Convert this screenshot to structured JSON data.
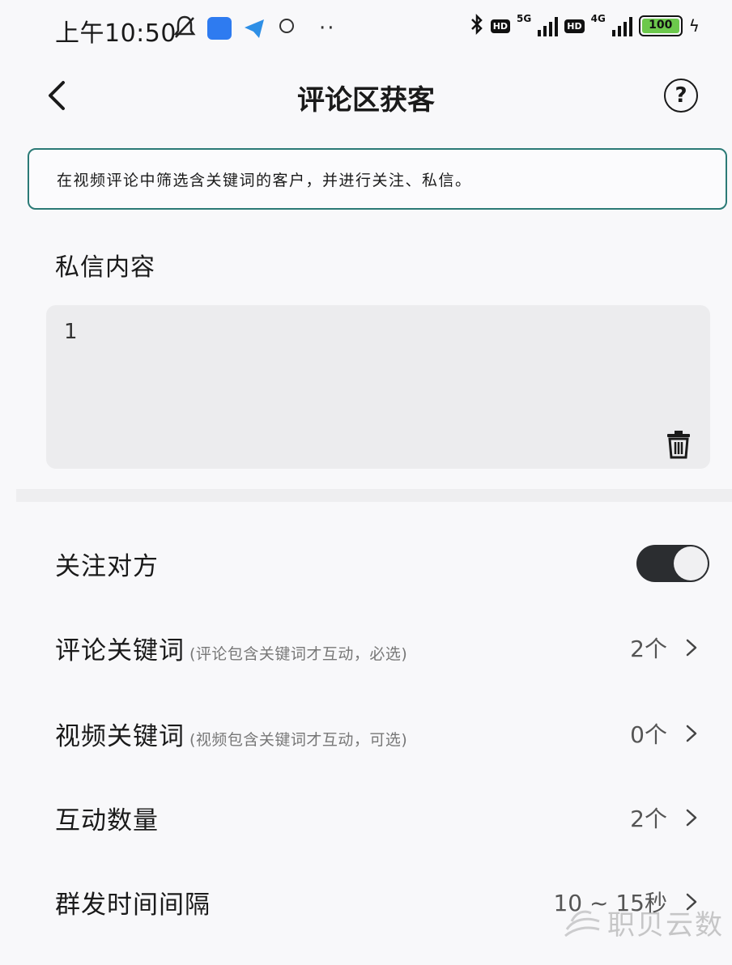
{
  "status_bar": {
    "time": "上午10:50",
    "dots": "··",
    "net1": "5G",
    "net2": "4G",
    "hd": "HD",
    "battery": "100"
  },
  "header": {
    "title": "评论区获客",
    "help_symbol": "?"
  },
  "banner": {
    "text": "在视频评论中筛选含关键词的客户，并进行关注、私信。"
  },
  "message": {
    "label": "私信内容",
    "value": "1"
  },
  "settings": {
    "follow": {
      "label": "关注对方",
      "enabled": true
    },
    "rows": [
      {
        "label": "评论关键词",
        "hint": "(评论包含关键词才互动，必选)",
        "value": "2个"
      },
      {
        "label": "视频关键词",
        "hint": "(视频包含关键词才互动，可选)",
        "value": "0个"
      },
      {
        "label": "互动数量",
        "hint": "",
        "value": "2个"
      },
      {
        "label": "群发时间间隔",
        "hint": "",
        "value": "10 ~ 15秒"
      }
    ]
  },
  "watermark": {
    "text": "职贝云数"
  },
  "colors": {
    "banner_border": "#2b7a76",
    "toggle_on": "#2b2d30",
    "battery": "#6cc84c"
  }
}
